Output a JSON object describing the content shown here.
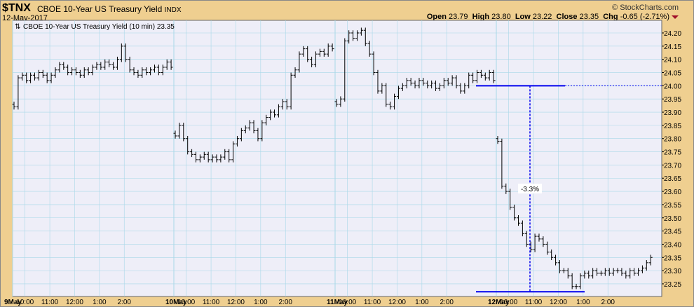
{
  "header": {
    "symbol": "$TNX",
    "name": "CBOE 10-Year US Treasury Yield",
    "exchange": "INDX",
    "date": "12-May-2017",
    "brand": "© StockCharts.com",
    "open_label": "Open",
    "open": "23.79",
    "high_label": "High",
    "high": "23.80",
    "low_label": "Low",
    "low": "23.22",
    "close_label": "Close",
    "close": "23.35",
    "chg_label": "Chg",
    "chg": "-0.65 (-2.71%)"
  },
  "chart_data": {
    "type": "ohlc",
    "legend": "CBOE 10-Year US Treasury Yield (10 min) 23.35",
    "ylim": [
      23.21,
      24.25
    ],
    "y_ticks": [
      "24.20",
      "24.15",
      "24.10",
      "24.05",
      "24.00",
      "23.95",
      "23.90",
      "23.85",
      "23.80",
      "23.75",
      "23.70",
      "23.65",
      "23.60",
      "23.55",
      "23.50",
      "23.45",
      "23.40",
      "23.35",
      "23.30",
      "23.25"
    ],
    "x_labels": [
      {
        "day": 0,
        "hour": 0,
        "text": "9May",
        "bold": true
      },
      {
        "day": 0,
        "hour": 0.5,
        "text": "10:00"
      },
      {
        "day": 0,
        "hour": 1.5,
        "text": "11:00"
      },
      {
        "day": 0,
        "hour": 2.5,
        "text": "12:00"
      },
      {
        "day": 0,
        "hour": 3.5,
        "text": "1:00"
      },
      {
        "day": 0,
        "hour": 4.5,
        "text": "2:00"
      },
      {
        "day": 1,
        "hour": 0,
        "text": "10May",
        "bold": true
      },
      {
        "day": 1,
        "hour": 0.5,
        "text": "10:00"
      },
      {
        "day": 1,
        "hour": 1.5,
        "text": "11:00"
      },
      {
        "day": 1,
        "hour": 2.5,
        "text": "12:00"
      },
      {
        "day": 1,
        "hour": 3.5,
        "text": "1:00"
      },
      {
        "day": 1,
        "hour": 4.5,
        "text": "2:00"
      },
      {
        "day": 2,
        "hour": 0,
        "text": "11May",
        "bold": true
      },
      {
        "day": 2,
        "hour": 0.5,
        "text": "10:00"
      },
      {
        "day": 2,
        "hour": 1.5,
        "text": "11:00"
      },
      {
        "day": 2,
        "hour": 2.5,
        "text": "12:00"
      },
      {
        "day": 2,
        "hour": 3.5,
        "text": "1:00"
      },
      {
        "day": 2,
        "hour": 4.5,
        "text": "2:00"
      },
      {
        "day": 3,
        "hour": 0,
        "text": "12May",
        "bold": true
      },
      {
        "day": 3,
        "hour": 0.5,
        "text": "10:00"
      },
      {
        "day": 3,
        "hour": 1.5,
        "text": "11:00"
      },
      {
        "day": 3,
        "hour": 2.5,
        "text": "12:00"
      },
      {
        "day": 3,
        "hour": 3.5,
        "text": "1:00"
      },
      {
        "day": 3,
        "hour": 4.5,
        "text": "2:00"
      }
    ],
    "closes": [
      [
        23.92,
        24.03,
        24.04,
        24.02,
        24.04,
        24.03,
        24.05,
        24.04,
        24.02,
        24.04,
        24.06,
        24.08,
        24.07,
        24.05,
        24.06,
        24.05,
        24.04,
        24.06,
        24.05,
        24.07,
        24.08,
        24.07,
        24.09,
        24.08,
        24.07,
        24.1,
        24.15,
        24.1,
        24.06,
        24.05,
        24.04,
        24.06,
        24.05,
        24.06,
        24.07,
        24.05,
        24.07,
        24.09,
        24.07
      ],
      [
        23.81,
        23.85,
        23.8,
        23.75,
        23.74,
        23.72,
        23.73,
        23.74,
        23.72,
        23.73,
        23.72,
        23.73,
        23.75,
        23.72,
        23.78,
        23.8,
        23.83,
        23.84,
        23.86,
        23.83,
        23.8,
        23.86,
        23.88,
        23.9,
        23.89,
        23.92,
        23.94,
        23.92,
        24.04,
        24.06,
        24.12,
        24.14,
        24.1,
        24.08,
        24.12,
        24.13,
        24.12,
        24.15,
        24.14
      ],
      [
        23.93,
        23.95,
        24.17,
        24.2,
        24.18,
        24.2,
        24.21,
        24.16,
        24.12,
        24.05,
        23.98,
        24.0,
        23.93,
        23.92,
        23.96,
        23.99,
        24.0,
        24.02,
        24.01,
        24.0,
        24.02,
        24.01,
        24.0,
        24.01,
        23.99,
        24.0,
        24.02,
        24.01,
        24.03,
        24.0,
        23.98,
        24.0,
        24.04,
        24.02,
        24.05,
        24.04,
        24.03,
        24.05,
        24.02
      ],
      [
        23.79,
        23.62,
        23.6,
        23.54,
        23.5,
        23.48,
        23.44,
        23.4,
        23.38,
        23.43,
        23.42,
        23.4,
        23.37,
        23.35,
        23.33,
        23.3,
        23.3,
        23.28,
        23.24,
        23.24,
        23.28,
        23.29,
        23.28,
        23.3,
        23.29,
        23.29,
        23.3,
        23.29,
        23.3,
        23.3,
        23.29,
        23.28,
        23.3,
        23.29,
        23.3,
        23.31,
        23.33,
        23.35
      ]
    ],
    "annotation": {
      "top_level": 24.0,
      "bottom_level": 23.22,
      "label": "-3.3%"
    },
    "colors": {
      "line": "#0000ee",
      "bars": "#000000",
      "grid": "#a8d8e8",
      "plot_bg": "#eeeef8"
    }
  }
}
